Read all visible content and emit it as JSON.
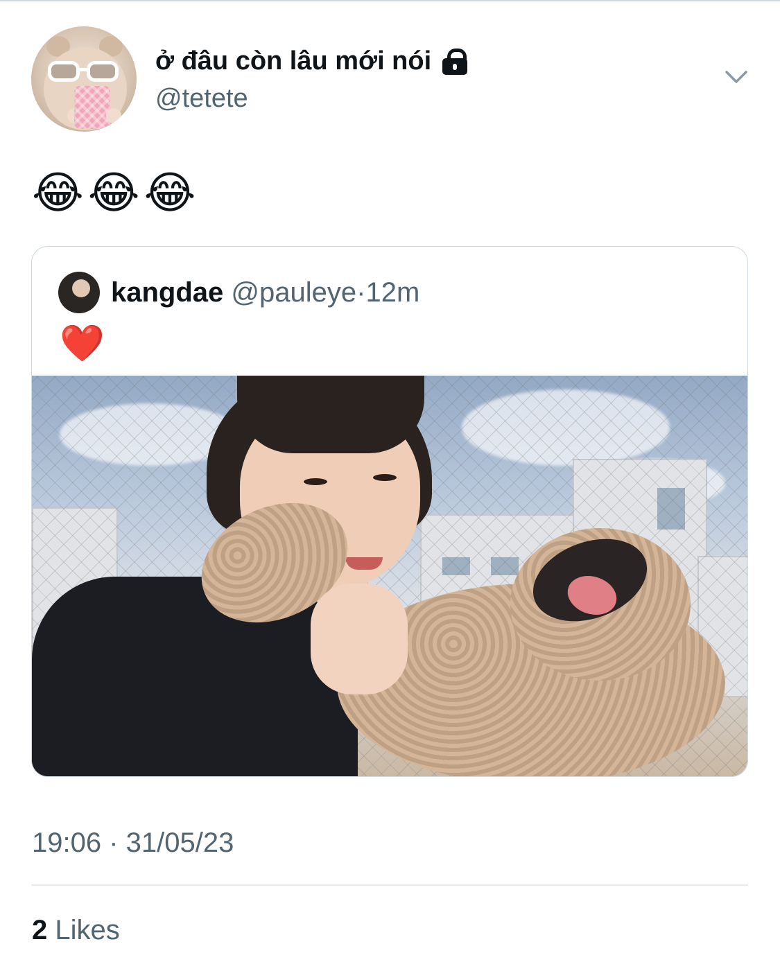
{
  "tweet": {
    "display_name": "ở đâu còn lâu mới nói",
    "handle": "@tetete",
    "text": "😂😂😂",
    "timestamp": "19:06 · 31/05/23",
    "likes_count": "2",
    "likes_label": "Likes"
  },
  "quoted_tweet": {
    "display_name": "kangdae",
    "handle": "@pauleye",
    "separator": "·",
    "time": "12m",
    "text": "❤️"
  },
  "icons": {
    "lock": "lock-icon",
    "chevron": "chevron-down-icon"
  },
  "colors": {
    "text_primary": "#0f1419",
    "text_secondary": "#536471",
    "border": "#cfd9de"
  }
}
